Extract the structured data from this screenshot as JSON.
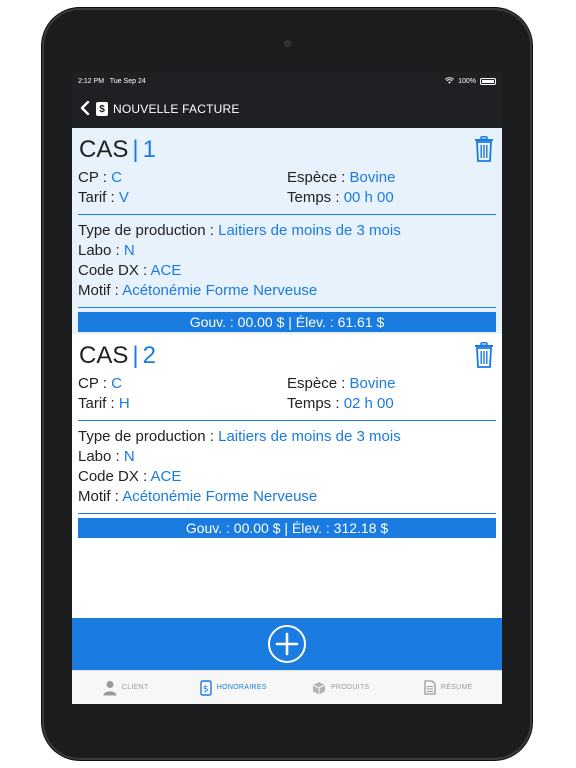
{
  "status": {
    "time": "2:12 PM",
    "date": "Tue Sep 24",
    "battery": "100%"
  },
  "nav": {
    "title": "NOUVELLE FACTURE",
    "badge": "$"
  },
  "cases": [
    {
      "label": "CAS",
      "sep": "|",
      "number": "1",
      "cp_label": "CP :",
      "cp": "C",
      "espece_label": "Espèce :",
      "espece": "Bovine",
      "tarif_label": "Tarif :",
      "tarif": "V",
      "temps_label": "Temps :",
      "temps": "00 h 00",
      "type_label": "Type de production :",
      "type": "Laitiers de moins de 3 mois",
      "labo_label": "Labo :",
      "labo": "N",
      "codedx_label": "Code DX :",
      "codedx": "ACE",
      "motif_label": "Motif :",
      "motif": "Acétonémie Forme Nerveuse",
      "totals": "Gouv. : 00.00 $ | Élev. : 61.61 $"
    },
    {
      "label": "CAS",
      "sep": "|",
      "number": "2",
      "cp_label": "CP :",
      "cp": "C",
      "espece_label": "Espèce :",
      "espece": "Bovine",
      "tarif_label": "Tarif :",
      "tarif": "H",
      "temps_label": "Temps :",
      "temps": "02 h 00",
      "type_label": "Type de production :",
      "type": "Laitiers de moins de 3 mois",
      "labo_label": "Labo :",
      "labo": "N",
      "codedx_label": "Code DX :",
      "codedx": "ACE",
      "motif_label": "Motif :",
      "motif": "Acétonémie Forme Nerveuse",
      "totals": "Gouv. : 00.00 $ | Élev. : 312.18 $"
    }
  ],
  "add_button": "+",
  "tabs": [
    {
      "label": "CLIENT",
      "icon": "person-icon",
      "active": false
    },
    {
      "label": "HONORAIRES",
      "icon": "invoice-dollar-icon",
      "active": true
    },
    {
      "label": "PRODUITS",
      "icon": "box-icon",
      "active": false
    },
    {
      "label": "RÉSUMÉ",
      "icon": "document-icon",
      "active": false
    }
  ],
  "colors": {
    "accent": "#1a7be0",
    "highlight": "#e8f2fc",
    "topbar": "#1f2024"
  }
}
